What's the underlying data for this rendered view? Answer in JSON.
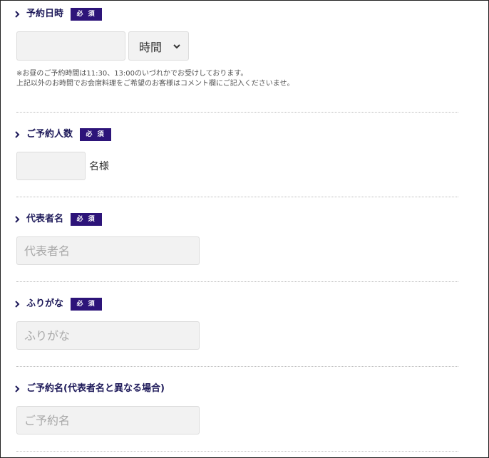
{
  "required_badge": "必 須",
  "reservation_datetime": {
    "label": "予約日時",
    "time_select_value": "時間",
    "note_lines": [
      "※お昼のご予約時間は11:30、13:00のいづれかでお受けしております。",
      "上記以外のお時間でお会席料理をご希望のお客様はコメント欄にご記入くださいませ。"
    ]
  },
  "party_size": {
    "label": "ご予約人数",
    "unit": "名様"
  },
  "representative": {
    "label": "代表者名",
    "placeholder": "代表者名"
  },
  "furigana": {
    "label": "ふりがな",
    "placeholder": "ふりがな"
  },
  "reservation_name": {
    "label": "ご予約名(代表者名と異なる場合)",
    "placeholder": "ご予約名"
  },
  "colors": {
    "label": "#1e1a5a",
    "badge_bg": "#2d1479",
    "field_bg": "#f2f2f2"
  }
}
